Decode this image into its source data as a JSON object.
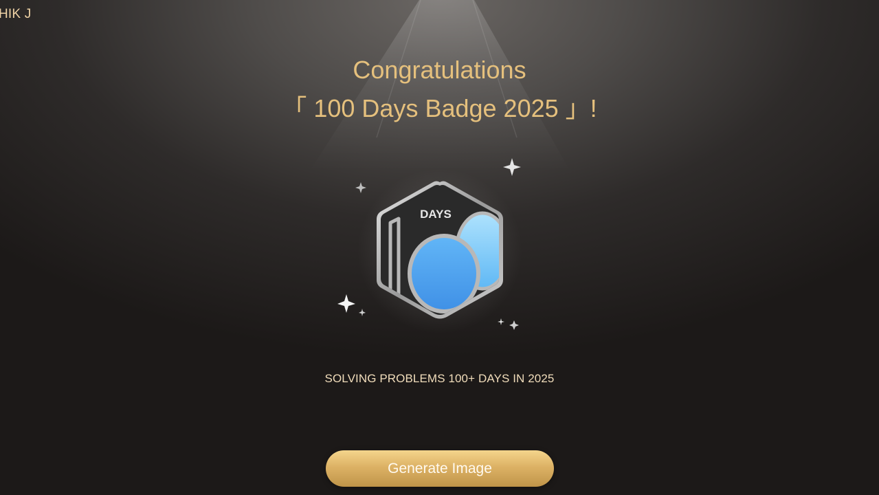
{
  "header": {
    "user_name": "HIK J"
  },
  "congrats": {
    "line1": "Congratulations",
    "line2": "「 100 Days Badge 2025 」!"
  },
  "badge": {
    "icon": "100-days-badge-icon",
    "days_label": "DAYS",
    "colors": {
      "frame": "#a7a7a7",
      "inner": "#2a2a2a",
      "accent_blue": "#4aa3f0",
      "accent_light_blue": "#8fd0fb"
    }
  },
  "description": "SOLVING PROBLEMS 100+ DAYS IN 2025",
  "actions": {
    "generate_label": "Generate Image"
  },
  "colors": {
    "headline": "#e5c07d",
    "button_gold": "#ddb265",
    "background": "#1c1918"
  }
}
